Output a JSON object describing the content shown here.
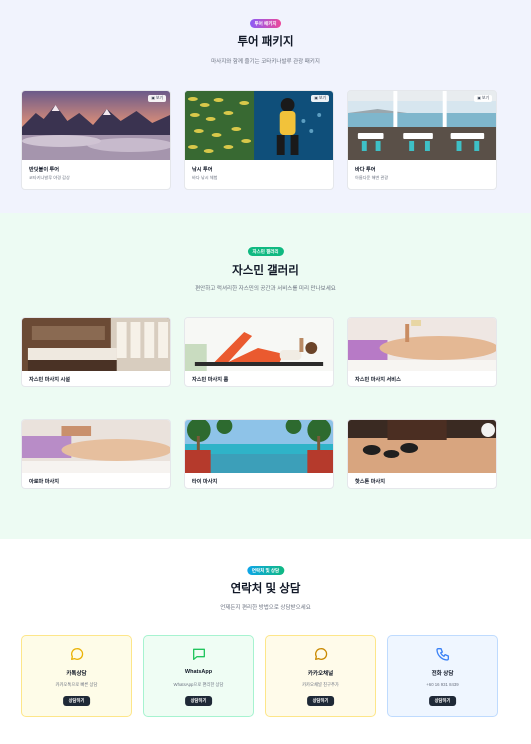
{
  "tours": {
    "badge": "투어 패키지",
    "title": "투어 패키지",
    "subtitle": "마사지와 함께 즐기는 코타키나발루 관광 패키지",
    "badge_color": "#8b5cf6",
    "cards": [
      {
        "title": "반딧불이 투어",
        "desc": "코타키나발루 야경 감상",
        "tag": "보기",
        "icon": "image-icon"
      },
      {
        "title": "낚시 투어",
        "desc": "바다 낚시 체험",
        "tag": "보기",
        "icon": "image-icon"
      },
      {
        "title": "바다 투어",
        "desc": "아름다운 해변 관광",
        "tag": "보기",
        "icon": "image-icon"
      }
    ]
  },
  "gallery": {
    "badge": "자스민 갤러리",
    "title": "자스민 갤러리",
    "subtitle": "편안하고 럭셔리한 자스민의 공간과 서비스를 미리 만나보세요",
    "badge_color": "#10b981",
    "items": [
      {
        "title": "자스민 마사지 시설"
      },
      {
        "title": "자스민 마사지 룸"
      },
      {
        "title": "자스민 마사지 서비스"
      },
      {
        "title": "아로마 마사지"
      },
      {
        "title": "타이 마사지"
      },
      {
        "title": "핫스톤 마사지"
      }
    ]
  },
  "contact": {
    "badge": "연락처 및 상담",
    "title": "연락처 및 상담",
    "subtitle": "언제든지 편리한 방법으로 상담받으세요",
    "badge_color": "#0ea5e9",
    "cards": [
      {
        "title": "카톡상담",
        "desc": "카카오톡으로 빠른 상담",
        "button": "상담하기",
        "icon": "chat-bubble-icon",
        "color": "#eab308",
        "bg": "#fefce8",
        "border": "#fde68a"
      },
      {
        "title": "WhatsApp",
        "desc": "WhatsApp으로 편리한 상담",
        "button": "상담하기",
        "icon": "message-square-icon",
        "color": "#22c55e",
        "bg": "#effdf4",
        "border": "#a7f3d0"
      },
      {
        "title": "카카오채널",
        "desc": "카카오채널 친구추가",
        "button": "상담하기",
        "icon": "chat-bubble-icon",
        "color": "#ca8a04",
        "bg": "#fffbea",
        "border": "#fde68a"
      },
      {
        "title": "전화 상담",
        "desc": "+60 16 931 8439",
        "button": "상담하기",
        "icon": "phone-icon",
        "color": "#3b82f6",
        "bg": "#eff6ff",
        "border": "#bfdbfe"
      }
    ]
  }
}
